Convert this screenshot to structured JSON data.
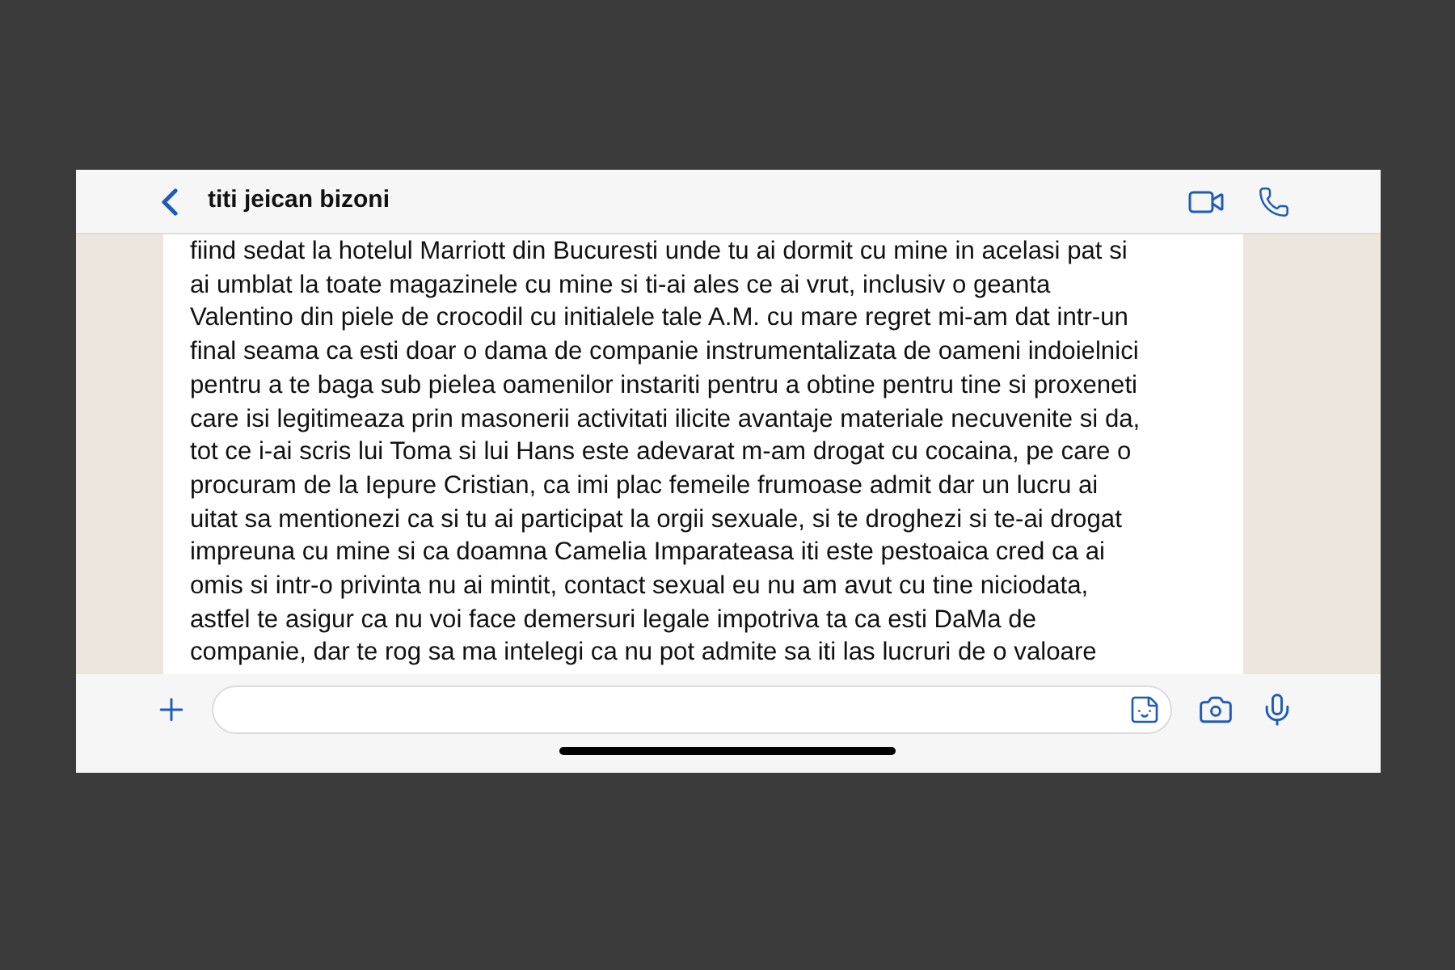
{
  "header": {
    "contact_name": "titi jeican bizoni"
  },
  "message": {
    "lines": [
      "fiind sedat la hotelul Marriott din Bucuresti unde tu ai dormit cu mine in acelasi pat si",
      "ai umblat la toate magazinele cu mine si ti-ai ales ce ai vrut, inclusiv o geanta",
      "Valentino din piele de crocodil cu initialele tale A.M. cu mare regret mi-am dat intr-un",
      "final seama ca esti doar o dama de companie instrumentalizata de oameni indoielnici",
      "pentru a te baga sub pielea oamenilor instariti pentru a obtine pentru tine si proxeneti",
      "care isi legitimeaza prin masonerii activitati ilicite avantaje materiale necuvenite si da,",
      "tot ce i-ai scris lui Toma si lui Hans este adevarat m-am drogat cu cocaina, pe care o",
      "procuram de la Iepure Cristian, ca imi plac femeile frumoase admit dar un lucru ai",
      "uitat sa mentionezi ca si tu ai participat la orgii sexuale, si te droghezi si te-ai drogat",
      "impreuna cu mine si ca doamna Camelia Imparateasa iti este pestoaica cred ca ai",
      "omis si intr-o privinta nu ai mintit, contact sexual eu nu am avut cu tine niciodata,",
      "astfel te asigur ca nu voi face demersuri legale impotriva ta ca esti DaMa de",
      "companie, dar te rog sa ma intelegi ca nu pot admite sa iti las lucruri de o valoare"
    ]
  }
}
